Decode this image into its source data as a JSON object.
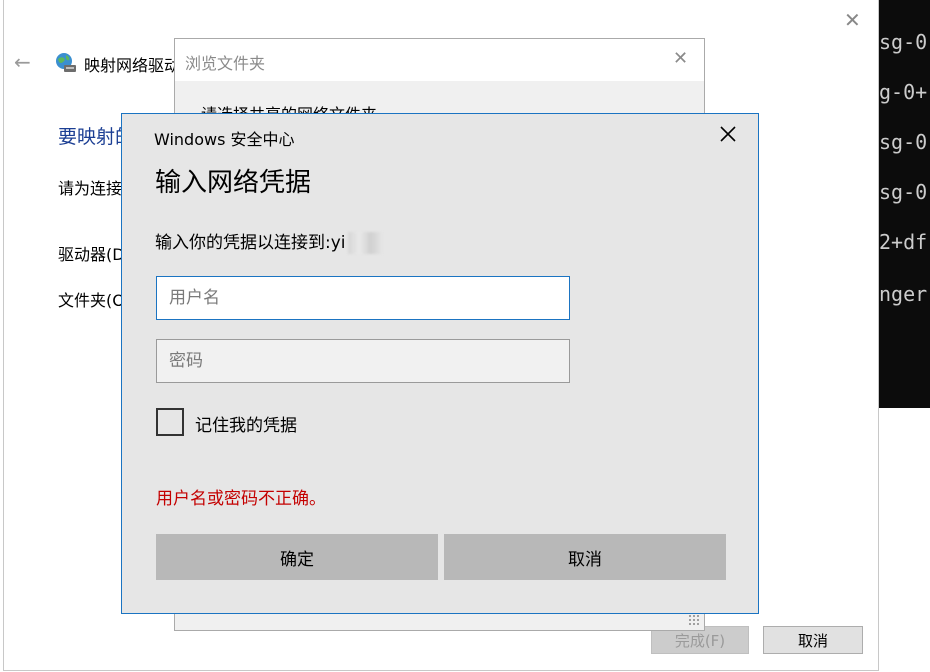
{
  "terminal": {
    "lines": [
      "sg-0",
      "g-0+",
      "sg-0",
      "sg-0",
      "2+df",
      "nger"
    ]
  },
  "wizard": {
    "title": "映射网络驱动",
    "heading": "要映射的",
    "instruction": "请为连接",
    "drive_label": "驱动器(D",
    "folder_label": "文件夹(O",
    "finish_label": "完成(F)",
    "cancel_label": "取消"
  },
  "browse": {
    "title": "浏览文件夹",
    "prompt": "请选择共享的网络文件夹"
  },
  "credential": {
    "window_title": "Windows 安全中心",
    "heading": "输入网络凭据",
    "description": "输入你的凭据以连接到:",
    "target_partial": "yi",
    "username_placeholder": "用户名",
    "password_placeholder": "密码",
    "remember_label": "记住我的凭据",
    "error_message": "用户名或密码不正确。",
    "ok_label": "确定",
    "cancel_label": "取消"
  },
  "colors": {
    "accent": "#1b74c2",
    "error": "#c40000",
    "heading_blue": "#1b3e93"
  }
}
